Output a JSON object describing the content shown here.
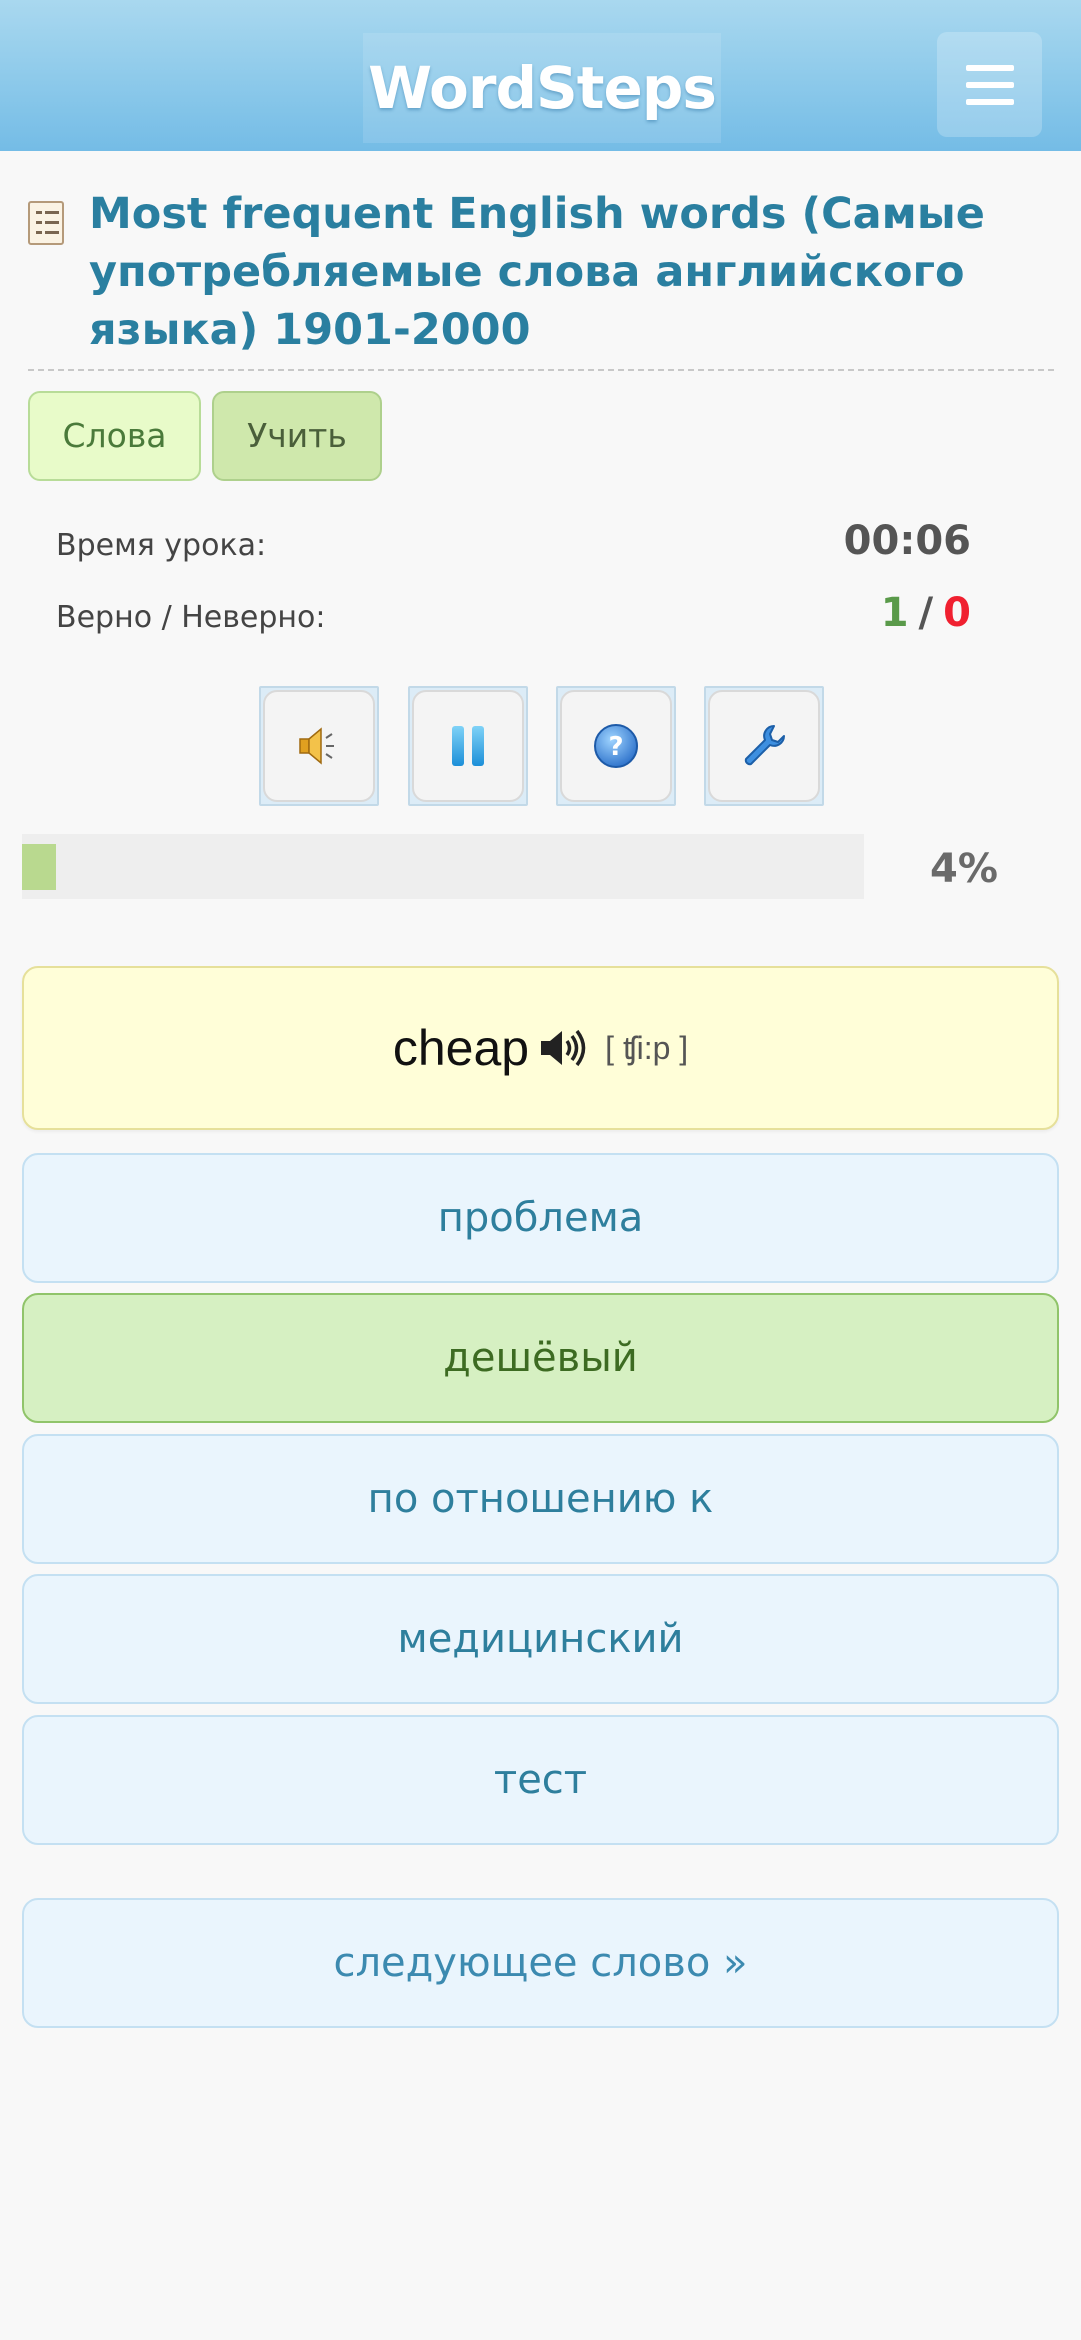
{
  "header": {
    "logo_text": "WordSteps"
  },
  "lesson": {
    "title": "Most frequent English words (Самые употребляемые слова английского языка) 1901-2000"
  },
  "tabs": [
    {
      "label": "Слова"
    },
    {
      "label": "Учить"
    }
  ],
  "stats": {
    "time_label": "Время урока:",
    "time_value": "00:06",
    "score_label": "Верно / Неверно:",
    "correct": "1",
    "separator": "/",
    "wrong": "0"
  },
  "controls": {
    "icons": [
      "speaker-icon",
      "pause-icon",
      "help-icon",
      "wrench-icon"
    ]
  },
  "progress": {
    "percent": 4,
    "label": "4%"
  },
  "word": {
    "text": "cheap",
    "transcription": "[ ʧi:p ]"
  },
  "options": [
    {
      "label": "проблема",
      "state": "normal"
    },
    {
      "label": "дешёвый",
      "state": "correct"
    },
    {
      "label": "по отношению к",
      "state": "normal"
    },
    {
      "label": "медицинский",
      "state": "normal"
    },
    {
      "label": "тест",
      "state": "normal"
    }
  ],
  "next": {
    "label": "следующее слово »"
  },
  "colors": {
    "header_top": "#a9d8ef",
    "header_bottom": "#74bce6",
    "title": "#2a7fa0",
    "correct_green": "#5a9a4a",
    "wrong_red": "#f02030",
    "progress_fill": "#b9d98f",
    "option_bg": "#eaf5fd",
    "correct_bg": "#d6f0c2",
    "word_card_bg": "#fffed8"
  }
}
